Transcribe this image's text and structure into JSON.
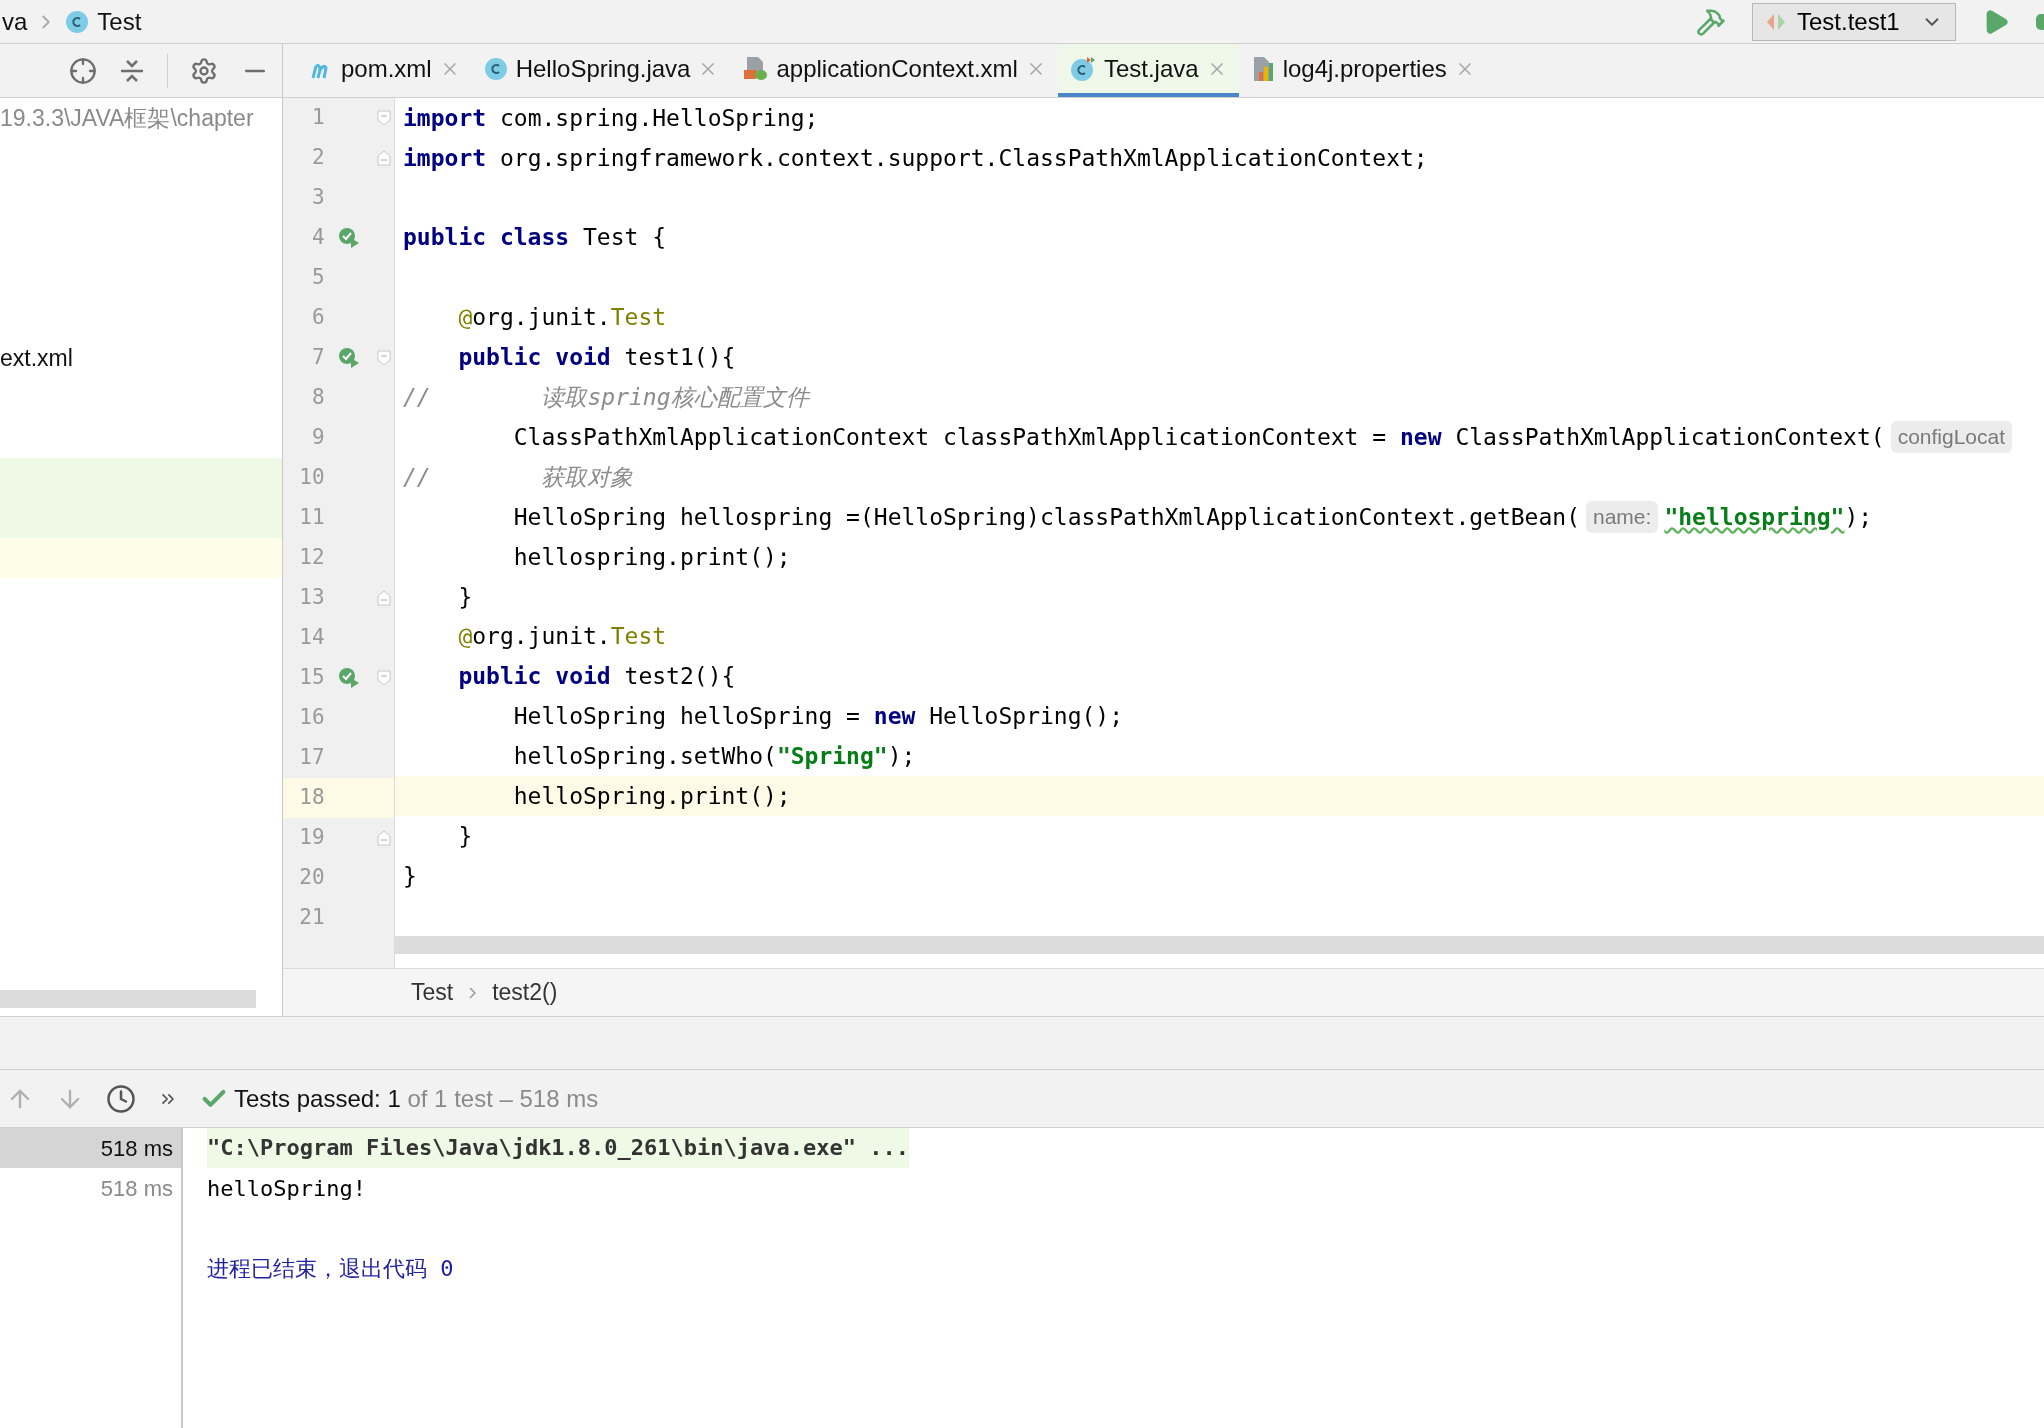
{
  "breadcrumb_top": {
    "items": [
      {
        "text": "va"
      },
      {
        "text": "Test",
        "kind": "class"
      }
    ]
  },
  "run_config": {
    "label": "Test.test1"
  },
  "sidebar": {
    "path_text": "19.3.3\\JAVA框架\\chapter",
    "file_text": "ext.xml",
    "highlighted_rows": [
      {
        "color": "#eef9e6"
      },
      {
        "color": "#eef9e6"
      },
      {
        "color": "#fefee8"
      }
    ]
  },
  "tabs": [
    {
      "label": "pom.xml",
      "kind": "maven",
      "selected": false
    },
    {
      "label": "HelloSpring.java",
      "kind": "class",
      "selected": false
    },
    {
      "label": "applicationContext.xml",
      "kind": "xml",
      "selected": false
    },
    {
      "label": "Test.java",
      "kind": "test",
      "selected": true
    },
    {
      "label": "log4j.properties",
      "kind": "properties",
      "selected": false
    }
  ],
  "editor": {
    "lines": [
      {
        "number": "1",
        "fold_open": true,
        "tokens": [
          {
            "kind": "keyword",
            "text": "import"
          },
          {
            "kind": "plain",
            "text": " com.spring.HelloSpring;"
          }
        ]
      },
      {
        "number": "2",
        "fold_close": true,
        "tokens": [
          {
            "kind": "keyword",
            "text": "import"
          },
          {
            "kind": "plain",
            "text": " org.springframework.context.support.ClassPathXmlApplicationContext;"
          }
        ]
      },
      {
        "number": "3"
      },
      {
        "number": "4",
        "run": true,
        "tokens": [
          {
            "kind": "keyword",
            "text": "public class"
          },
          {
            "kind": "plain",
            "text": " Test {"
          }
        ]
      },
      {
        "number": "5"
      },
      {
        "number": "6",
        "tokens": [
          {
            "kind": "annotation",
            "text": "    @"
          },
          {
            "kind": "plain",
            "text": "org.junit."
          },
          {
            "kind": "annotation",
            "text": "Test"
          }
        ]
      },
      {
        "number": "7",
        "run": true,
        "fold_open": true,
        "tokens": [
          {
            "kind": "keyword",
            "text": "    public void"
          },
          {
            "kind": "plain",
            "text": " test1(){"
          }
        ]
      },
      {
        "number": "8",
        "tokens": [
          {
            "kind": "comment",
            "text": "//        读取spring核心配置文件"
          }
        ]
      },
      {
        "number": "9",
        "tokens": [
          {
            "kind": "plain",
            "text": "        ClassPathXmlApplicationContext classPathXmlApplicationContext = "
          },
          {
            "kind": "keyword",
            "text": "new"
          },
          {
            "kind": "plain",
            "text": " ClassPathXmlApplicationContext("
          },
          {
            "kind": "hint",
            "text": "configLocat"
          }
        ]
      },
      {
        "number": "10",
        "tokens": [
          {
            "kind": "comment",
            "text": "//        获取对象"
          }
        ]
      },
      {
        "number": "11",
        "tokens": [
          {
            "kind": "plain",
            "text": "        HelloSpring hellospring =(HelloSpring)classPathXmlApplicationContext.getBean("
          },
          {
            "kind": "hint",
            "text": "name:"
          },
          {
            "kind": "string",
            "text": "\"hellospring\"",
            "typo": true
          },
          {
            "kind": "plain",
            "text": ");"
          }
        ]
      },
      {
        "number": "12",
        "tokens": [
          {
            "kind": "plain",
            "text": "        hellospring.print();"
          }
        ]
      },
      {
        "number": "13",
        "fold_close": true,
        "tokens": [
          {
            "kind": "plain",
            "text": "    }"
          }
        ]
      },
      {
        "number": "14",
        "tokens": [
          {
            "kind": "annotation",
            "text": "    @"
          },
          {
            "kind": "plain",
            "text": "org.junit."
          },
          {
            "kind": "annotation",
            "text": "Test"
          }
        ]
      },
      {
        "number": "15",
        "run": true,
        "fold_open": true,
        "tokens": [
          {
            "kind": "keyword",
            "text": "    public void"
          },
          {
            "kind": "plain",
            "text": " test2(){"
          }
        ]
      },
      {
        "number": "16",
        "tokens": [
          {
            "kind": "plain",
            "text": "        HelloSpring helloSpring = "
          },
          {
            "kind": "keyword",
            "text": "new"
          },
          {
            "kind": "plain",
            "text": " HelloSpring();"
          }
        ]
      },
      {
        "number": "17",
        "tokens": [
          {
            "kind": "plain",
            "text": "        helloSpring.setWho("
          },
          {
            "kind": "string",
            "text": "\"Spring\""
          },
          {
            "kind": "plain",
            "text": ");"
          }
        ]
      },
      {
        "number": "18",
        "current": true,
        "tokens": [
          {
            "kind": "plain",
            "text": "        helloSpring.print();"
          }
        ]
      },
      {
        "number": "19",
        "fold_close": true,
        "tokens": [
          {
            "kind": "plain",
            "text": "    }"
          }
        ]
      },
      {
        "number": "20",
        "tokens": [
          {
            "kind": "plain",
            "text": "}"
          }
        ]
      },
      {
        "number": "21"
      }
    ]
  },
  "code_breadcrumb": [
    "Test",
    "test2()"
  ],
  "test_status": {
    "passed_label": "Tests passed: 1",
    "detail": " of 1 test – 518 ms"
  },
  "test_tree": [
    {
      "duration": "518 ms",
      "selected": true
    },
    {
      "duration": "518 ms",
      "selected": false
    }
  ],
  "console": [
    {
      "kind": "command",
      "text": "\"C:\\Program Files\\Java\\jdk1.8.0_261\\bin\\java.exe\" ..."
    },
    {
      "kind": "output",
      "text": "helloSpring!"
    },
    {
      "kind": "blank"
    },
    {
      "kind": "exit",
      "text": "进程已结束，退出代码 0"
    }
  ]
}
